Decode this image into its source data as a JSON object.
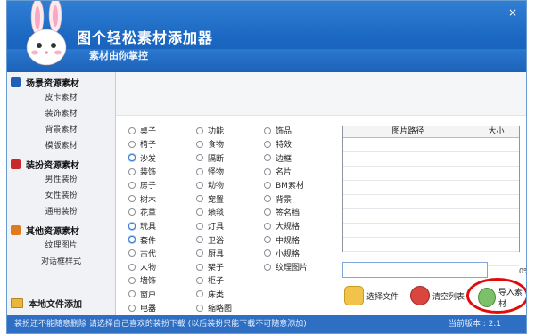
{
  "window": {
    "title": "图个轻松素材添加器",
    "subtitle": "素材由你掌控",
    "close_icon": "×"
  },
  "sidebar": {
    "sections": [
      {
        "title": "场景资源素材",
        "icon": "star-icon",
        "color": "#1f5fb5",
        "items": [
          "皮卡素材",
          "装饰素材",
          "背景素材",
          "模版素材"
        ]
      },
      {
        "title": "装扮资源素材",
        "icon": "dress-icon",
        "color": "#c9282a",
        "items": [
          "男性装扮",
          "女性装扮",
          "通用装扮"
        ]
      },
      {
        "title": "其他资源素材",
        "icon": "box-icon",
        "color": "#e07a1f",
        "items": [
          "纹理图片",
          "对话框样式"
        ]
      }
    ],
    "local_label": "本地文件添加"
  },
  "options": {
    "columns": [
      [
        "桌子",
        "椅子",
        "沙发",
        "装饰",
        "房子",
        "树木",
        "花草",
        "玩具",
        "套件",
        "古代",
        "人物",
        "墙饰",
        "窗户",
        "电器"
      ],
      [
        "功能",
        "食物",
        "隔断",
        "怪物",
        "动物",
        "宠置",
        "地毯",
        "灯具",
        "卫浴",
        "厨具",
        "架子",
        "柜子",
        "床类",
        "缩略图"
      ],
      [
        "饰品",
        "特效",
        "边框",
        "名片",
        "BM素材",
        "背景",
        "签名档",
        "大规格",
        "中规格",
        "小规格",
        "纹理图片"
      ]
    ],
    "highlighted": [
      "沙发",
      "玩具",
      "套件"
    ]
  },
  "table": {
    "col_path": "图片路径",
    "col_size": "大小",
    "rows": 9
  },
  "progress": {
    "percent_label": "0%",
    "value": 0
  },
  "actions": {
    "select_file": "选择文件",
    "clear_list": "清空列表",
    "import": "导入素材"
  },
  "status": {
    "message": "装扮还不能随意删除 请选择自己喜欢的装扮下载 (以后装扮只能下载不可随意添加)",
    "version": "当前版本 : 2.1"
  },
  "colors": {
    "accent": "#1a66c1",
    "highlight_ring": "#e10b0b"
  }
}
